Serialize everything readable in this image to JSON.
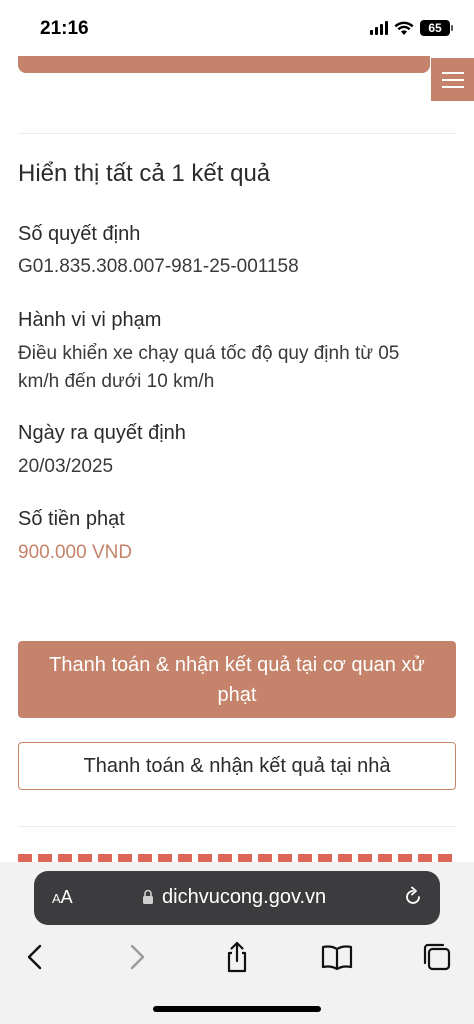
{
  "status_bar": {
    "time": "21:16",
    "battery": "65"
  },
  "results": {
    "title": "Hiển thị tất cả 1 kết quả",
    "fields": [
      {
        "label": "Số quyết định",
        "value": "G01.835.308.007-981-25-001158"
      },
      {
        "label": "Hành vi vi phạm",
        "value": "Điều khiển xe chạy quá tốc độ quy định từ 05 km/h đến dưới 10 km/h"
      },
      {
        "label": "Ngày ra quyết định",
        "value": "20/03/2025"
      },
      {
        "label": "Số tiền phạt",
        "value": "900.000 VND"
      }
    ]
  },
  "actions": {
    "primary_label": "Thanh toán & nhận kết quả tại cơ quan xử phạt",
    "secondary_label": "Thanh toán & nhận kết quả tại nhà"
  },
  "browser": {
    "aa_label": "AA",
    "url": "dichvucong.gov.vn"
  },
  "colors": {
    "accent": "#c4836a",
    "cut_text": "#d64b3a"
  },
  "icons": [
    "menu-icon",
    "lock-icon",
    "reload-icon",
    "back-icon",
    "forward-icon",
    "share-icon",
    "bookmarks-icon",
    "tabs-icon"
  ]
}
